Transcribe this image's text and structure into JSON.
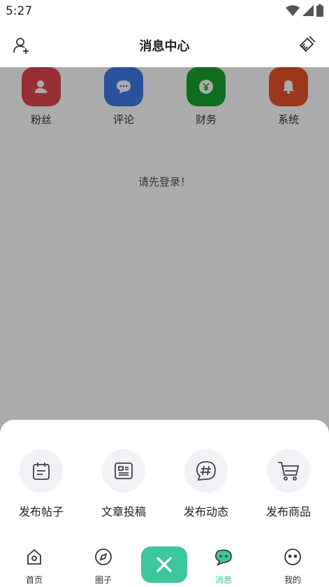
{
  "status_bar": {
    "time": "5:27"
  },
  "header": {
    "title": "消息中心",
    "left_icon": "add-user-icon",
    "right_icon": "broom-icon"
  },
  "categories": [
    {
      "label": "粉丝",
      "icon": "user-plus-icon",
      "color": "#e0454c"
    },
    {
      "label": "评论",
      "icon": "chat-bubble-icon",
      "color": "#3f7be8"
    },
    {
      "label": "财务",
      "icon": "yen-coin-icon",
      "color": "#17a52e"
    },
    {
      "label": "系统",
      "icon": "bell-icon",
      "color": "#e8542a"
    }
  ],
  "empty_message": "请先登录！",
  "publish_sheet": {
    "actions": [
      {
        "label": "发布帖子",
        "icon": "calendar-note-icon"
      },
      {
        "label": "文章投稿",
        "icon": "article-icon"
      },
      {
        "label": "发布动态",
        "icon": "hashtag-icon"
      },
      {
        "label": "发布商品",
        "icon": "shopping-cart-icon"
      }
    ]
  },
  "tabbar": {
    "items": [
      {
        "label": "首页",
        "icon": "home-icon"
      },
      {
        "label": "圈子",
        "icon": "compass-icon"
      },
      {
        "label": "消息",
        "icon": "message-icon",
        "active": true
      },
      {
        "label": "我的",
        "icon": "profile-icon"
      }
    ],
    "fab_icon": "close-icon"
  },
  "colors": {
    "accent": "#3cc79c",
    "overlay": "rgba(0,0,0,0.33)"
  }
}
